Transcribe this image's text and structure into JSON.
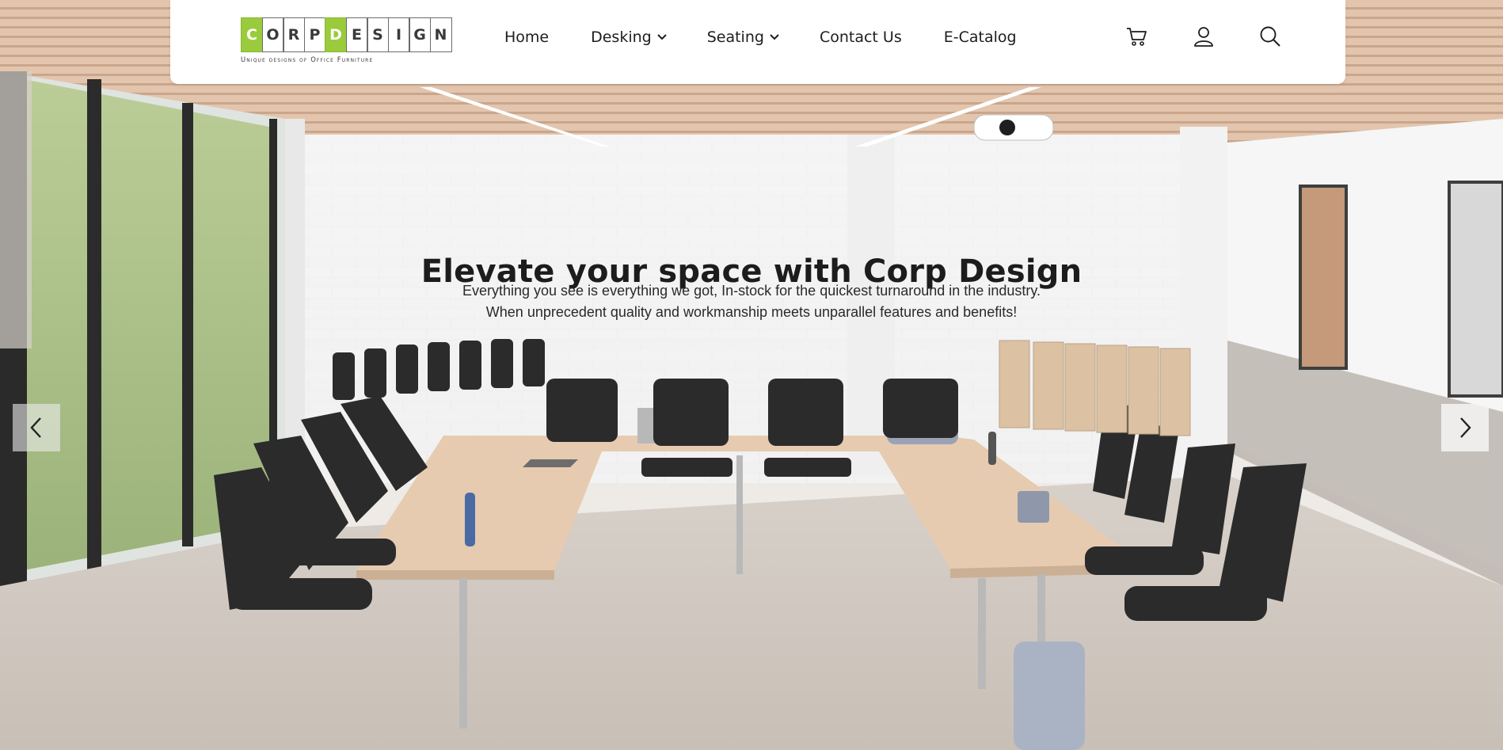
{
  "brand": {
    "letters": [
      "C",
      "O",
      "R",
      "P",
      "D",
      "E",
      "S",
      "I",
      "G",
      "N"
    ],
    "tagline": "Unique designs of Office Furniture",
    "accent_color": "#9acb3c"
  },
  "nav": {
    "items": [
      {
        "label": "Home",
        "has_dropdown": false
      },
      {
        "label": "Desking",
        "has_dropdown": true
      },
      {
        "label": "Seating",
        "has_dropdown": true
      },
      {
        "label": "Contact Us",
        "has_dropdown": false
      },
      {
        "label": "E-Catalog",
        "has_dropdown": false
      }
    ],
    "icons": [
      "cart-icon",
      "user-icon",
      "search-icon"
    ]
  },
  "hero": {
    "title": "Elevate your space with Corp Design",
    "subtitle_line1": "Everything you see is everything we got, In-stock for the quickest turnaround in the industry.",
    "subtitle_line2": "When unprecedent quality and workmanship meets unparallel features and benefits!",
    "prev_icon": "chevron-left-icon",
    "next_icon": "chevron-right-icon"
  }
}
